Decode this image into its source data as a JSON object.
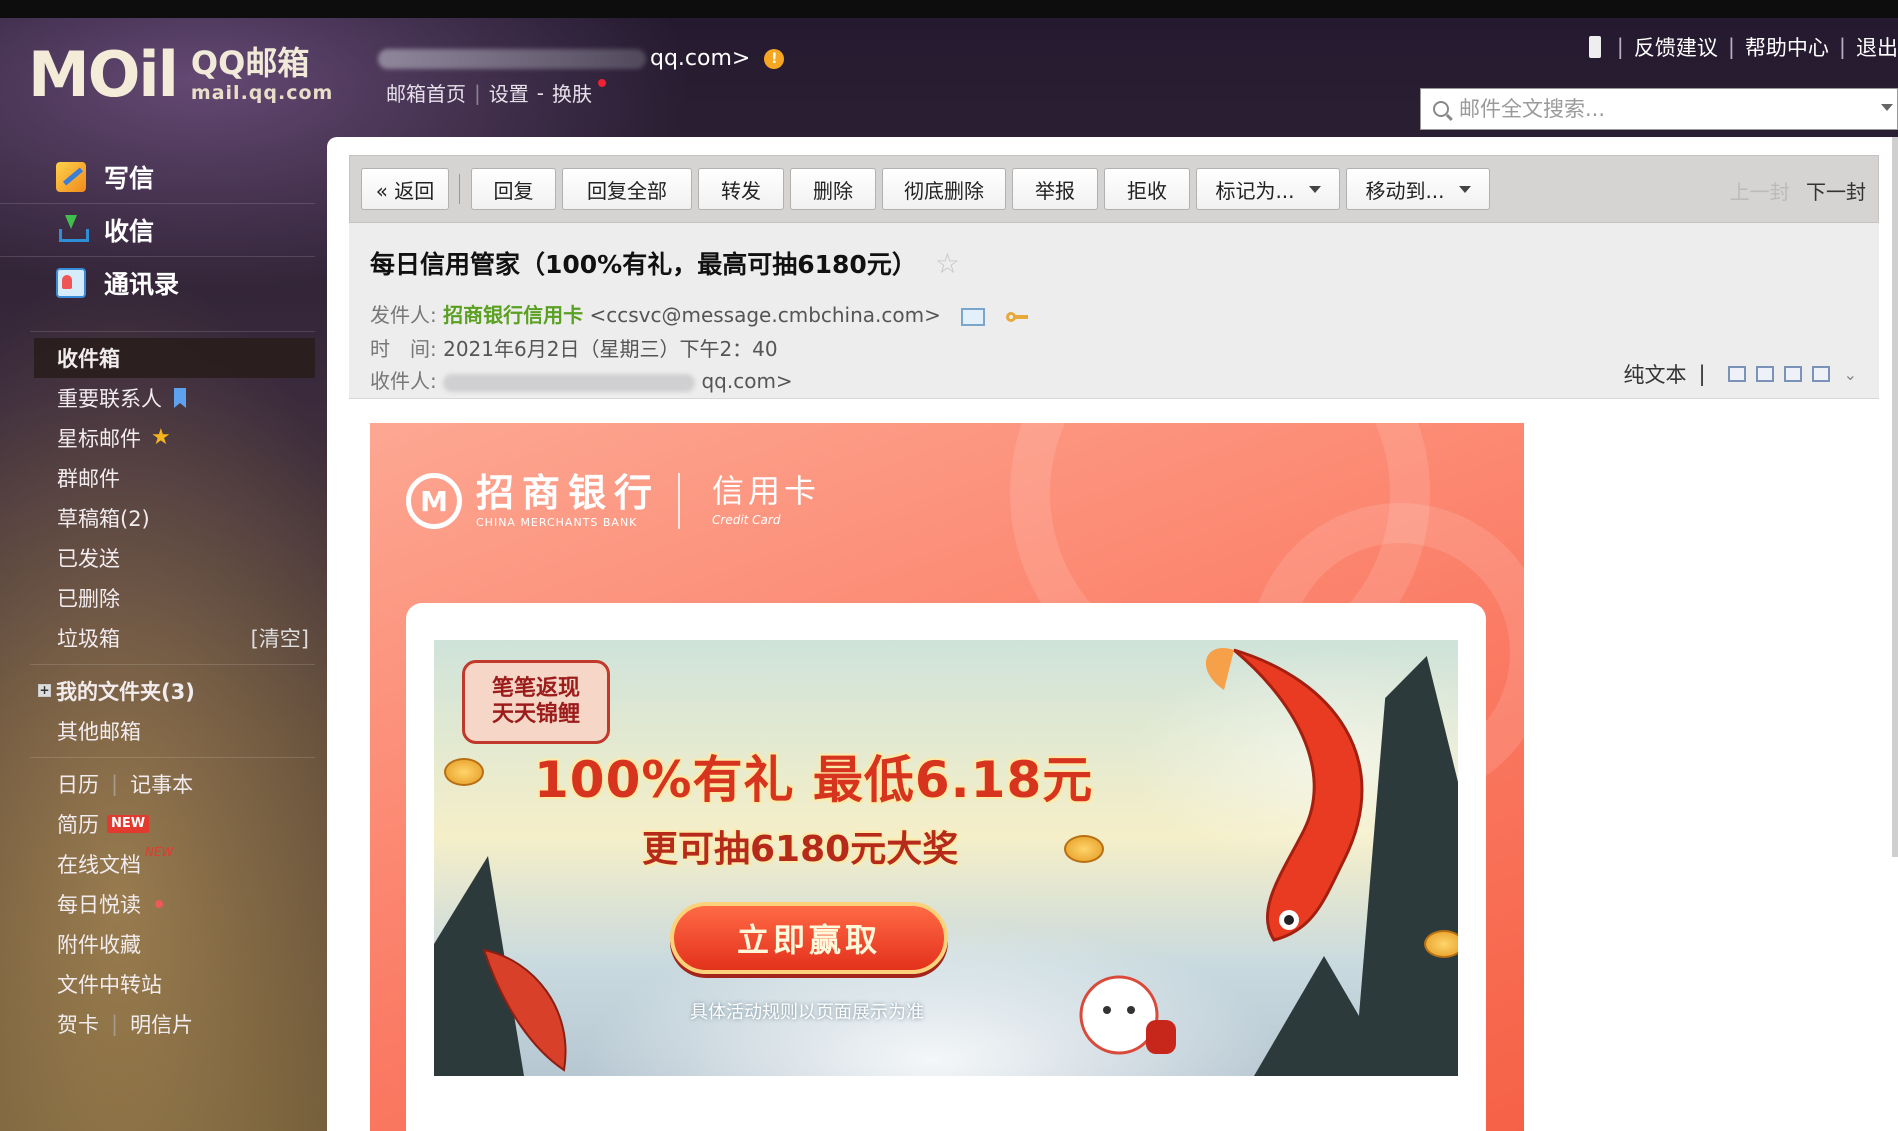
{
  "header": {
    "logo_main": "MOil",
    "logo_qq": "QQ邮箱",
    "logo_sub": "mail.qq.com",
    "account_suffix": "qq.com>",
    "warning_mark": "!",
    "subnav": [
      "邮箱首页",
      "设置",
      "-",
      "换肤"
    ],
    "toplinks": [
      "反馈建议",
      "帮助中心",
      "退出"
    ],
    "search_placeholder": "邮件全文搜索..."
  },
  "sidebar": {
    "primary": [
      {
        "label": "写信",
        "icon": "write-icon"
      },
      {
        "label": "收信",
        "icon": "inbox-icon"
      },
      {
        "label": "通讯录",
        "icon": "contacts-icon"
      }
    ],
    "folders": {
      "inbox": "收件箱",
      "important": "重要联系人",
      "starred": "星标邮件",
      "group": "群邮件",
      "drafts": "草稿箱(2)",
      "sent": "已发送",
      "deleted": "已删除",
      "spam": "垃圾箱",
      "spam_action": "[清空]",
      "my_folders": "我的文件夹(3)",
      "other_mailbox": "其他邮箱",
      "calendar": "日历",
      "notebook": "记事本",
      "resume": "简历",
      "resume_badge": "NEW",
      "docs": "在线文档",
      "docs_badge": "NEW",
      "daily_read": "每日悦读",
      "attachments": "附件收藏",
      "transfer": "文件中转站",
      "cards": "贺卡",
      "postcards": "明信片"
    }
  },
  "toolbar": {
    "back": "« 返回",
    "reply": "回复",
    "reply_all": "回复全部",
    "forward": "转发",
    "delete": "删除",
    "delete_permanent": "彻底删除",
    "report": "举报",
    "reject": "拒收",
    "mark_as": "标记为...",
    "move_to": "移动到...",
    "prev": "上一封",
    "next": "下一封"
  },
  "mail": {
    "subject": "每日信用管家（100%有礼，最高可抽6180元）",
    "star": "☆",
    "from_label": "发件人:",
    "from_name": "招商银行信用卡",
    "from_addr": "<ccsvc@message.cmbchina.com>",
    "time_label": "时　间:",
    "time_value": "2021年6月2日（星期三）下午2：40",
    "to_label": "收件人:",
    "to_suffix": "qq.com>",
    "plain_text": "纯文本"
  },
  "email_content": {
    "bank_name": "招商银行",
    "bank_en": "CHINA MERCHANTS BANK",
    "card_cn": "信用卡",
    "card_en": "Credit Card",
    "badge_line1": "笔笔返现",
    "badge_line2": "天天锦鲤",
    "headline": "100%有礼 最低6.18元",
    "subheadline": "更可抽6180元大奖",
    "cta": "立即赢取",
    "rule": "具体活动规则以页面展示为准"
  }
}
